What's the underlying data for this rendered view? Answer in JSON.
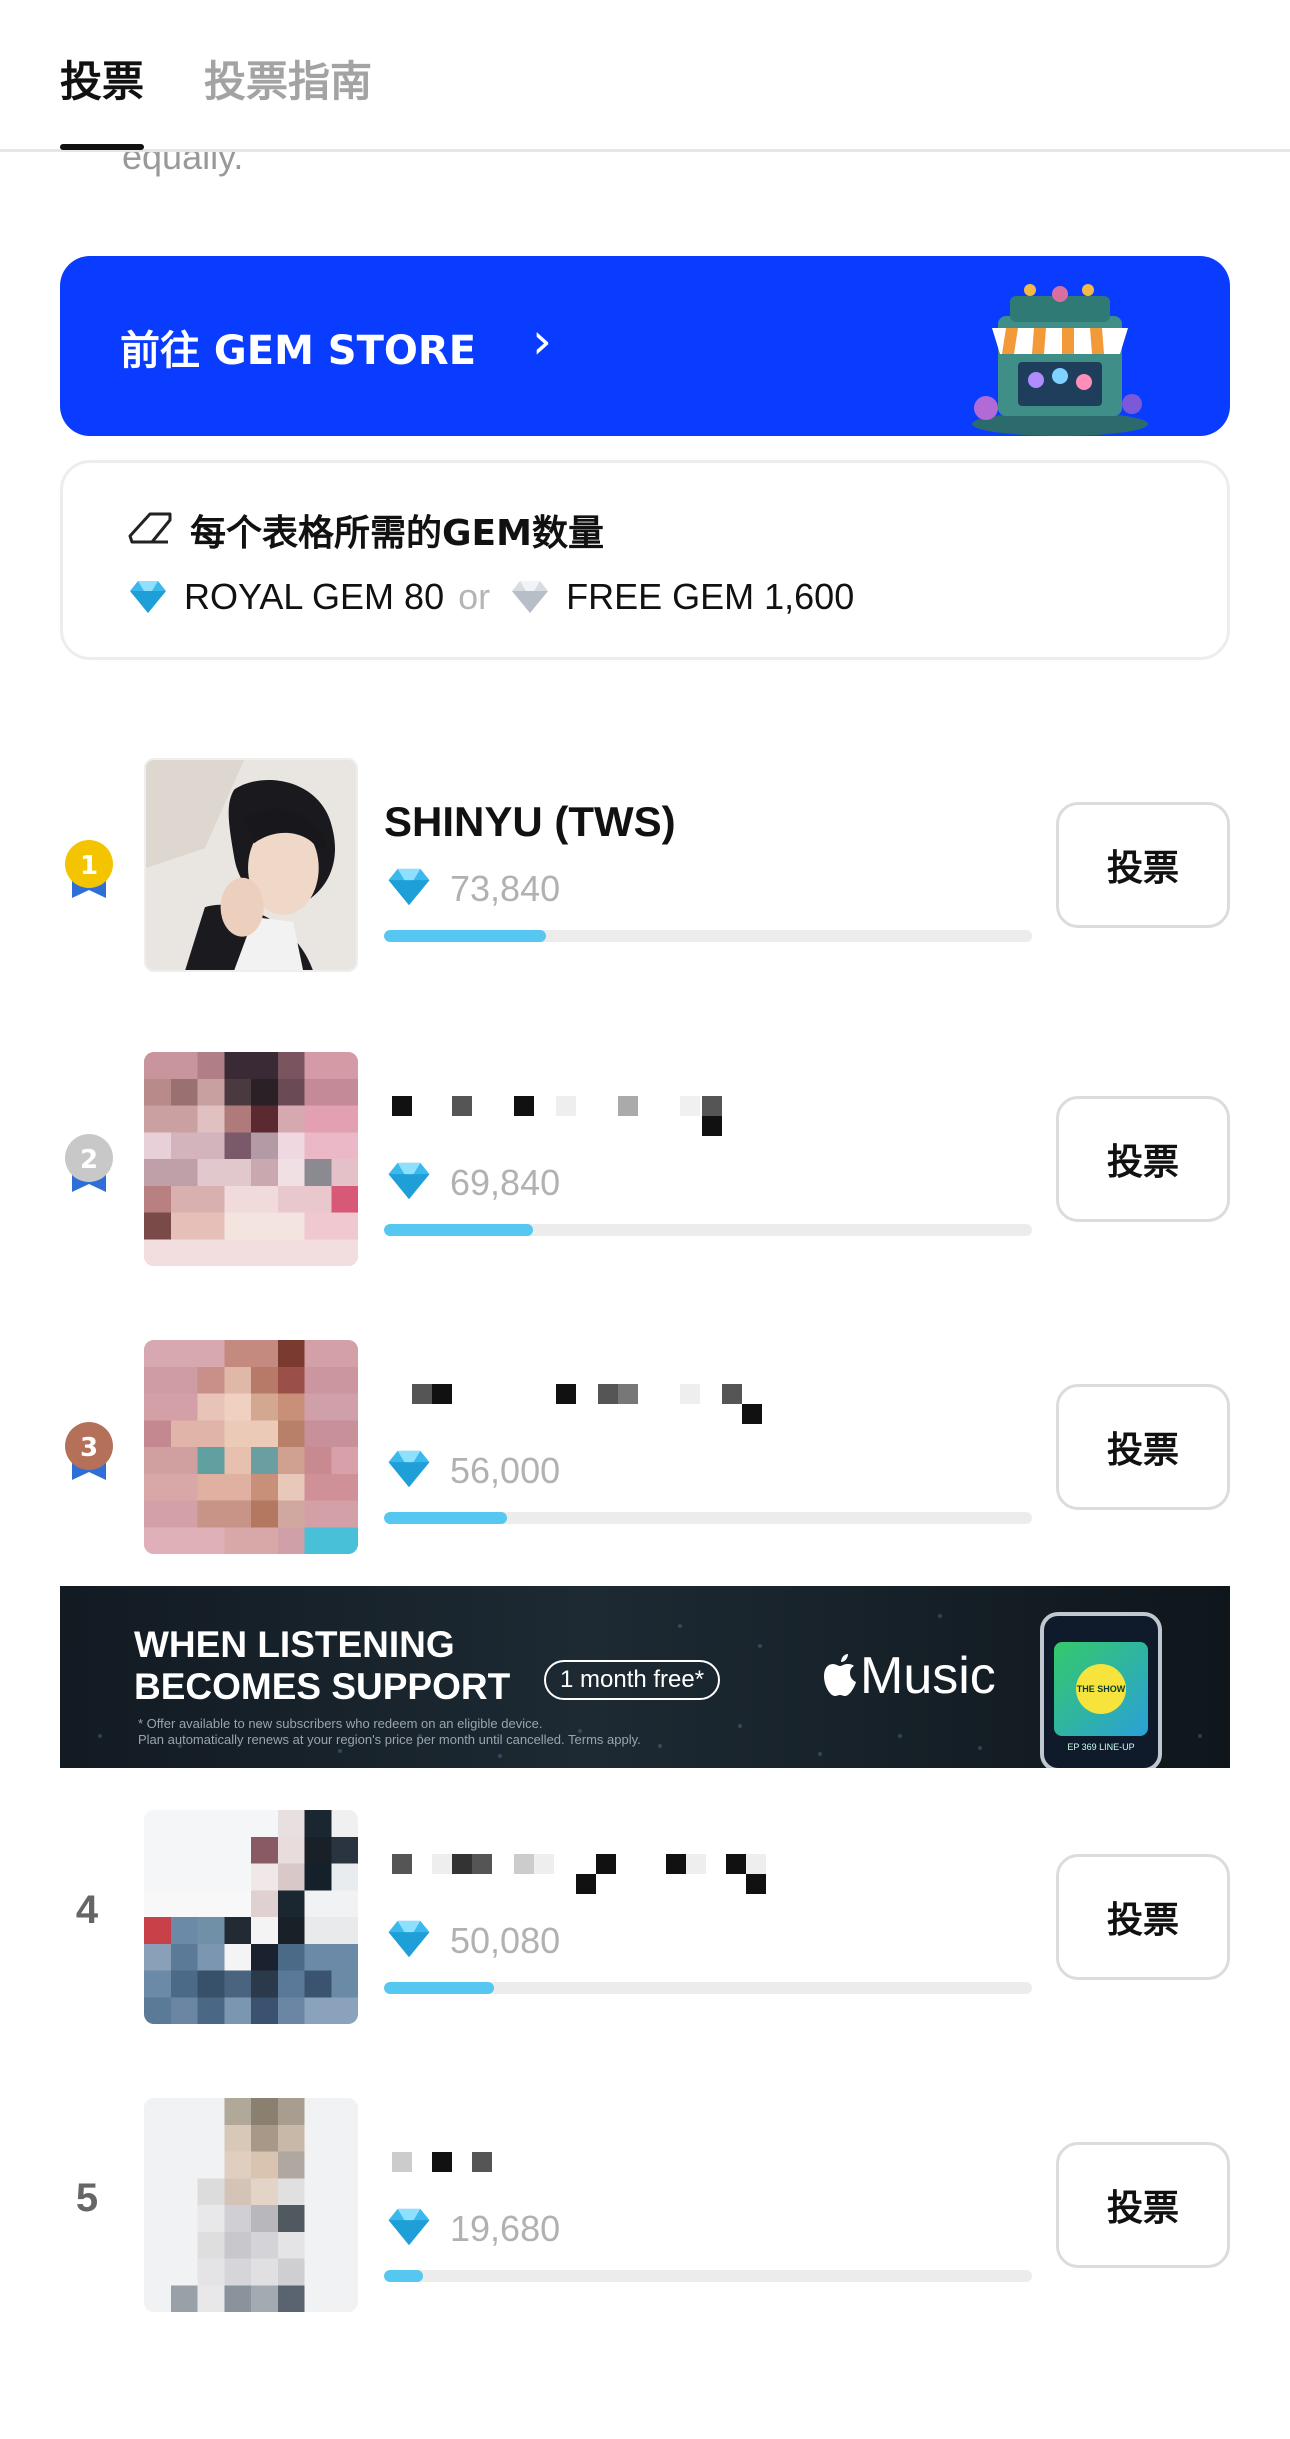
{
  "tabs": {
    "active": "投票",
    "inactive": "投票指南"
  },
  "ghost_text": "equally.",
  "gem_store_banner": {
    "label": "前往 GEM STORE",
    "chevron": "›"
  },
  "gem_requirement": {
    "title": "每个表格所需的GEM数量",
    "royal_label": "ROYAL GEM 80",
    "or_text": "or",
    "free_label": "FREE GEM 1,600"
  },
  "candidates": [
    {
      "rank": "1",
      "name": "SHINYU (TWS)",
      "votes": "73,840",
      "progress": 0.25,
      "vote_label": "投票"
    },
    {
      "rank": "2",
      "name": "",
      "votes": "69,840",
      "progress": 0.23,
      "vote_label": "投票"
    },
    {
      "rank": "3",
      "name": "",
      "votes": "56,000",
      "progress": 0.19,
      "vote_label": "投票"
    },
    {
      "rank": "4",
      "name": "",
      "votes": "50,080",
      "progress": 0.17,
      "vote_label": "投票"
    },
    {
      "rank": "5",
      "name": "",
      "votes": "19,680",
      "progress": 0.06,
      "vote_label": "投票"
    }
  ],
  "ad": {
    "headline_line1": "WHEN LISTENING",
    "headline_line2": "BECOMES SUPPORT",
    "pill": "1 month free*",
    "fine_line1": "* Offer available to new subscribers who redeem on an eligible device.",
    "fine_line2": "Plan automatically renews at your region's price per month until cancelled. Terms apply.",
    "brand": "Music",
    "phone_text1": "THE SHOW",
    "phone_text2": "EP 369 LINE-UP"
  },
  "colors": {
    "accent_blue": "#0a3cff",
    "progress": "#56c7f1",
    "gold": "#f5c400",
    "silver": "#c8c8c8",
    "bronze": "#b5705a"
  }
}
